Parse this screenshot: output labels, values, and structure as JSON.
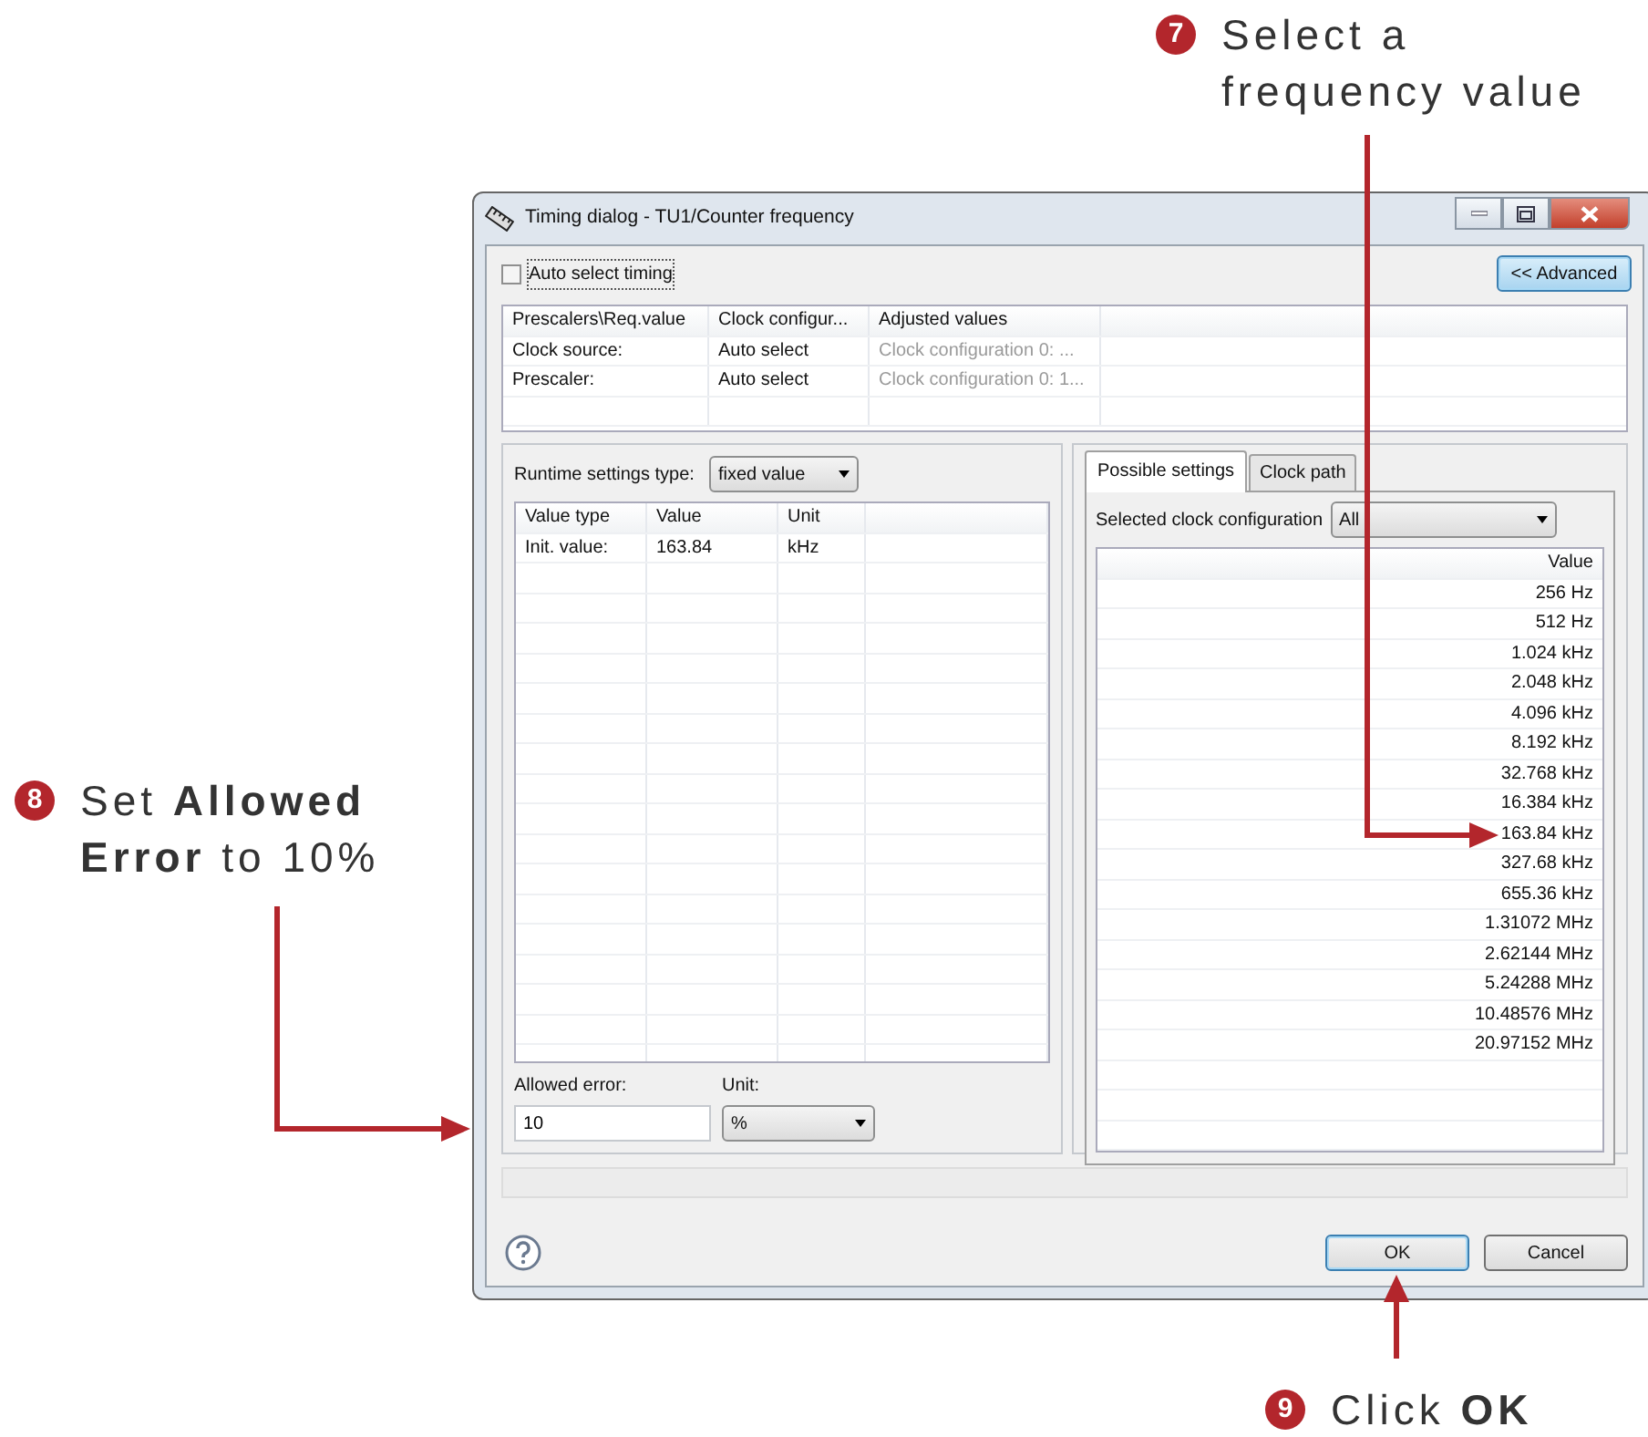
{
  "annotations": [
    {
      "number": "7",
      "text": "Select a frequency value"
    },
    {
      "number": "8",
      "text": "Set **Allowed Error** to 10%"
    },
    {
      "number": "9",
      "text": "Click **OK**"
    }
  ],
  "dialog": {
    "title": "Timing dialog - TU1/Counter frequency",
    "auto_select_timing": {
      "label": "Auto select timing",
      "checked": false
    },
    "advanced_button": "<< Advanced",
    "timing_table": {
      "columns": [
        {
          "label": "Prescalers\\Req.value",
          "dimmed": false
        },
        {
          "label": "Clock configur...",
          "dimmed": false
        },
        {
          "label": "Adjusted values",
          "dimmed": true
        }
      ],
      "rows": [
        [
          "Clock source:",
          "Auto select",
          "Clock configuration 0: ..."
        ],
        [
          "Prescaler:",
          "Auto select",
          "Clock configuration 0: 1..."
        ]
      ]
    },
    "runtime_settings": {
      "label": "Runtime settings type:",
      "value": "fixed value"
    },
    "value_table": {
      "columns": [
        "Value type",
        "Value",
        "Unit"
      ],
      "rows": [
        [
          "Init. value:",
          "163.84",
          "kHz"
        ]
      ]
    },
    "allowed_error": {
      "label": "Allowed error:",
      "value": "10"
    },
    "unit": {
      "label": "Unit:",
      "value": "%"
    },
    "tabs": [
      {
        "label": "Possible settings",
        "selected": true
      },
      {
        "label": "Clock path",
        "selected": false
      }
    ],
    "clock_configuration": {
      "label": "Selected clock configuration",
      "value": "All"
    },
    "possible_values": {
      "column": "Value",
      "values": [
        "256 Hz",
        "512 Hz",
        "1.024 kHz",
        "2.048 kHz",
        "4.096 kHz",
        "8.192 kHz",
        "32.768 kHz",
        "16.384 kHz",
        "163.84 kHz",
        "327.68 kHz",
        "655.36 kHz",
        "1.31072 MHz",
        "2.62144 MHz",
        "5.24288 MHz",
        "10.48576 MHz",
        "20.97152 MHz"
      ]
    },
    "buttons": [
      {
        "label": "OK",
        "default": true
      },
      {
        "label": "Cancel",
        "default": false
      }
    ]
  }
}
